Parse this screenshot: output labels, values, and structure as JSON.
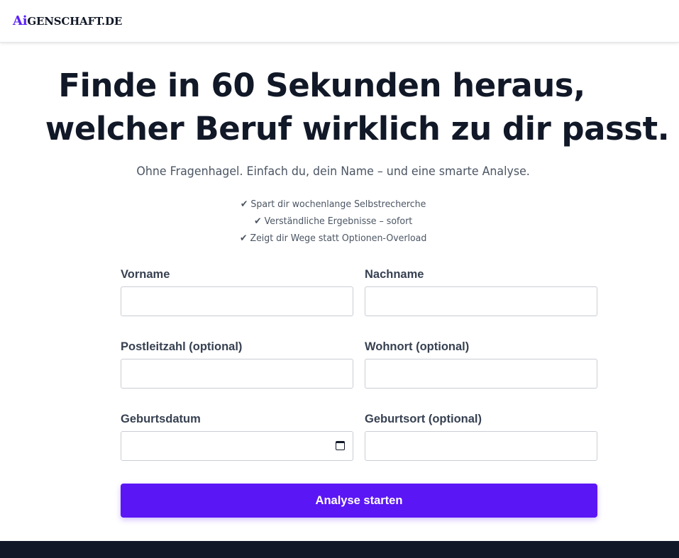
{
  "header": {
    "logo_ai": "Ai",
    "logo_rest": "GENSCHAFT.DE"
  },
  "hero": {
    "headline_line1": "Finde in 60 Sekunden heraus,",
    "headline_line2": "welcher Beruf wirklich zu dir passt.",
    "subtitle": "Ohne Fragenhagel. Einfach du, dein Name – und eine smarte Analyse.",
    "benefits": [
      "✔ Spart dir wochenlange Selbstrecherche",
      "✔ Verständliche Ergebnisse – sofort",
      "✔ Zeigt dir Wege statt Optionen-Overload"
    ]
  },
  "form": {
    "fields": [
      {
        "label": "Vorname",
        "value": ""
      },
      {
        "label": "Nachname",
        "value": ""
      },
      {
        "label": "Postleitzahl (optional)",
        "value": ""
      },
      {
        "label": "Wohnort (optional)",
        "value": ""
      },
      {
        "label": "Geburtsdatum",
        "value": "",
        "icon": "calendar-icon"
      },
      {
        "label": "Geburtsort (optional)",
        "value": ""
      }
    ],
    "submit_label": "Analyse starten"
  },
  "colors": {
    "accent": "#5b16f5",
    "text_dark": "#111827",
    "footer_bg": "#111827"
  }
}
